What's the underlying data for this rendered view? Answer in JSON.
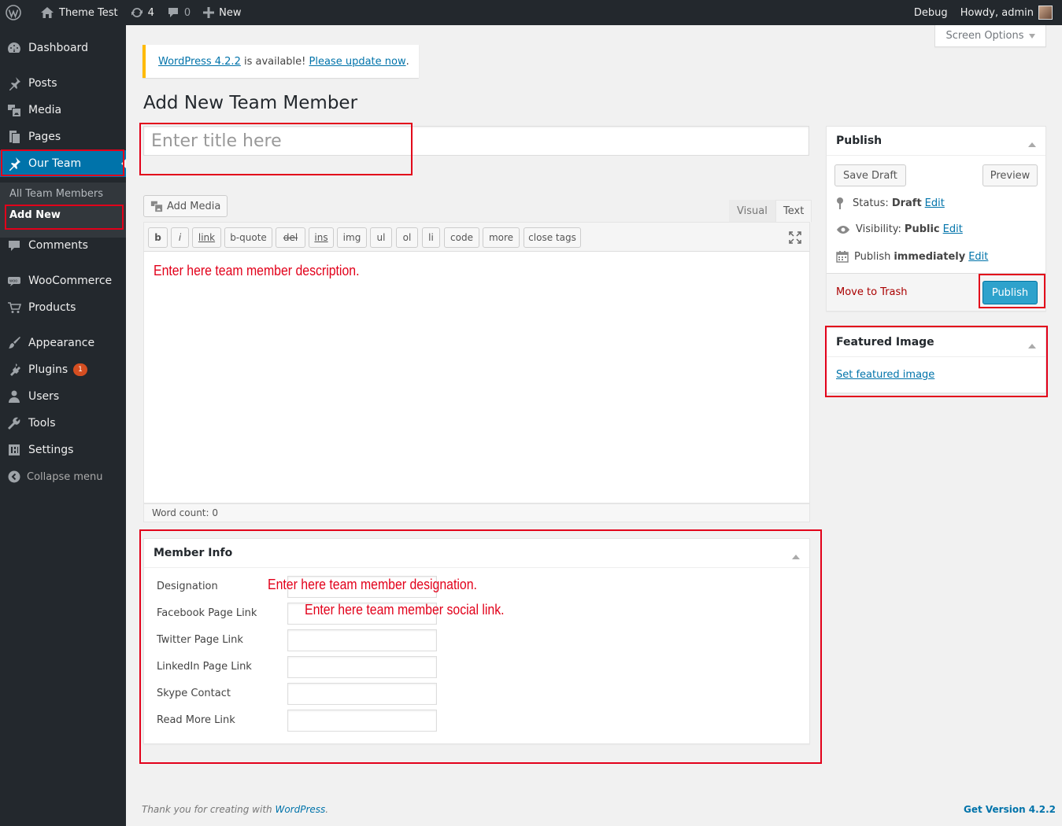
{
  "adminbar": {
    "site_name": "Theme Test",
    "updates_count": "4",
    "comments_count": "0",
    "new_label": "New",
    "debug_label": "Debug",
    "howdy_label": "Howdy, admin"
  },
  "sidebar": {
    "items": [
      {
        "label": "Dashboard",
        "icon": "dashboard-icon"
      },
      {
        "label": "Posts",
        "icon": "pin-icon"
      },
      {
        "label": "Media",
        "icon": "media-icon"
      },
      {
        "label": "Pages",
        "icon": "pages-icon"
      },
      {
        "label": "Our Team",
        "icon": "pin-icon"
      },
      {
        "label": "Comments",
        "icon": "comment-icon"
      },
      {
        "label": "WooCommerce",
        "icon": "woo-icon"
      },
      {
        "label": "Products",
        "icon": "cart-icon"
      },
      {
        "label": "Appearance",
        "icon": "brush-icon"
      },
      {
        "label": "Plugins",
        "icon": "plugin-icon"
      },
      {
        "label": "Users",
        "icon": "user-icon"
      },
      {
        "label": "Tools",
        "icon": "wrench-icon"
      },
      {
        "label": "Settings",
        "icon": "settings-icon"
      }
    ],
    "submenu": [
      "All Team Members",
      "Add New"
    ],
    "plugins_badge": "1",
    "collapse_label": "Collapse menu"
  },
  "screen_options": "Screen Options",
  "notice": {
    "version_link": "WordPress 4.2.2",
    "middle_text": " is available! ",
    "update_link": "Please update now",
    "end_text": "."
  },
  "page_title": "Add New Team Member",
  "title_placeholder": "Enter title here",
  "editor": {
    "add_media": "Add Media",
    "tab_visual": "Visual",
    "tab_text": "Text",
    "quicktags": [
      "b",
      "i",
      "link",
      "b-quote",
      "del",
      "ins",
      "img",
      "ul",
      "ol",
      "li",
      "code",
      "more",
      "close tags"
    ],
    "word_count": "Word count: 0"
  },
  "member_info": {
    "title": "Member Info",
    "fields": [
      "Designation",
      "Facebook Page Link",
      "Twitter Page Link",
      "LinkedIn Page Link",
      "Skype Contact",
      "Read More Link"
    ]
  },
  "annotations": {
    "description": "Enter here team member description.",
    "designation": "Enter here team member designation.",
    "social": "Enter here team member social link."
  },
  "publish_box": {
    "title": "Publish",
    "save_draft": "Save Draft",
    "preview": "Preview",
    "status_label": "Status:",
    "status_value": "Draft",
    "visibility_label": "Visibility:",
    "visibility_value": "Public",
    "publish_label": "Publish",
    "publish_value": "immediately",
    "edit_link": "Edit",
    "move_to_trash": "Move to Trash",
    "publish_button": "Publish"
  },
  "featured_image": {
    "title": "Featured Image",
    "set_link": "Set featured image"
  },
  "footer": {
    "thank_you": "Thank you for creating with ",
    "wp_link": "WordPress",
    "period": ".",
    "version": "Get Version 4.2.2"
  },
  "colors": {
    "sidebar_bg": "#23282d",
    "accent": "#0073aa",
    "annotation": "#e2001a",
    "publish_button": "#2ea2cc"
  }
}
